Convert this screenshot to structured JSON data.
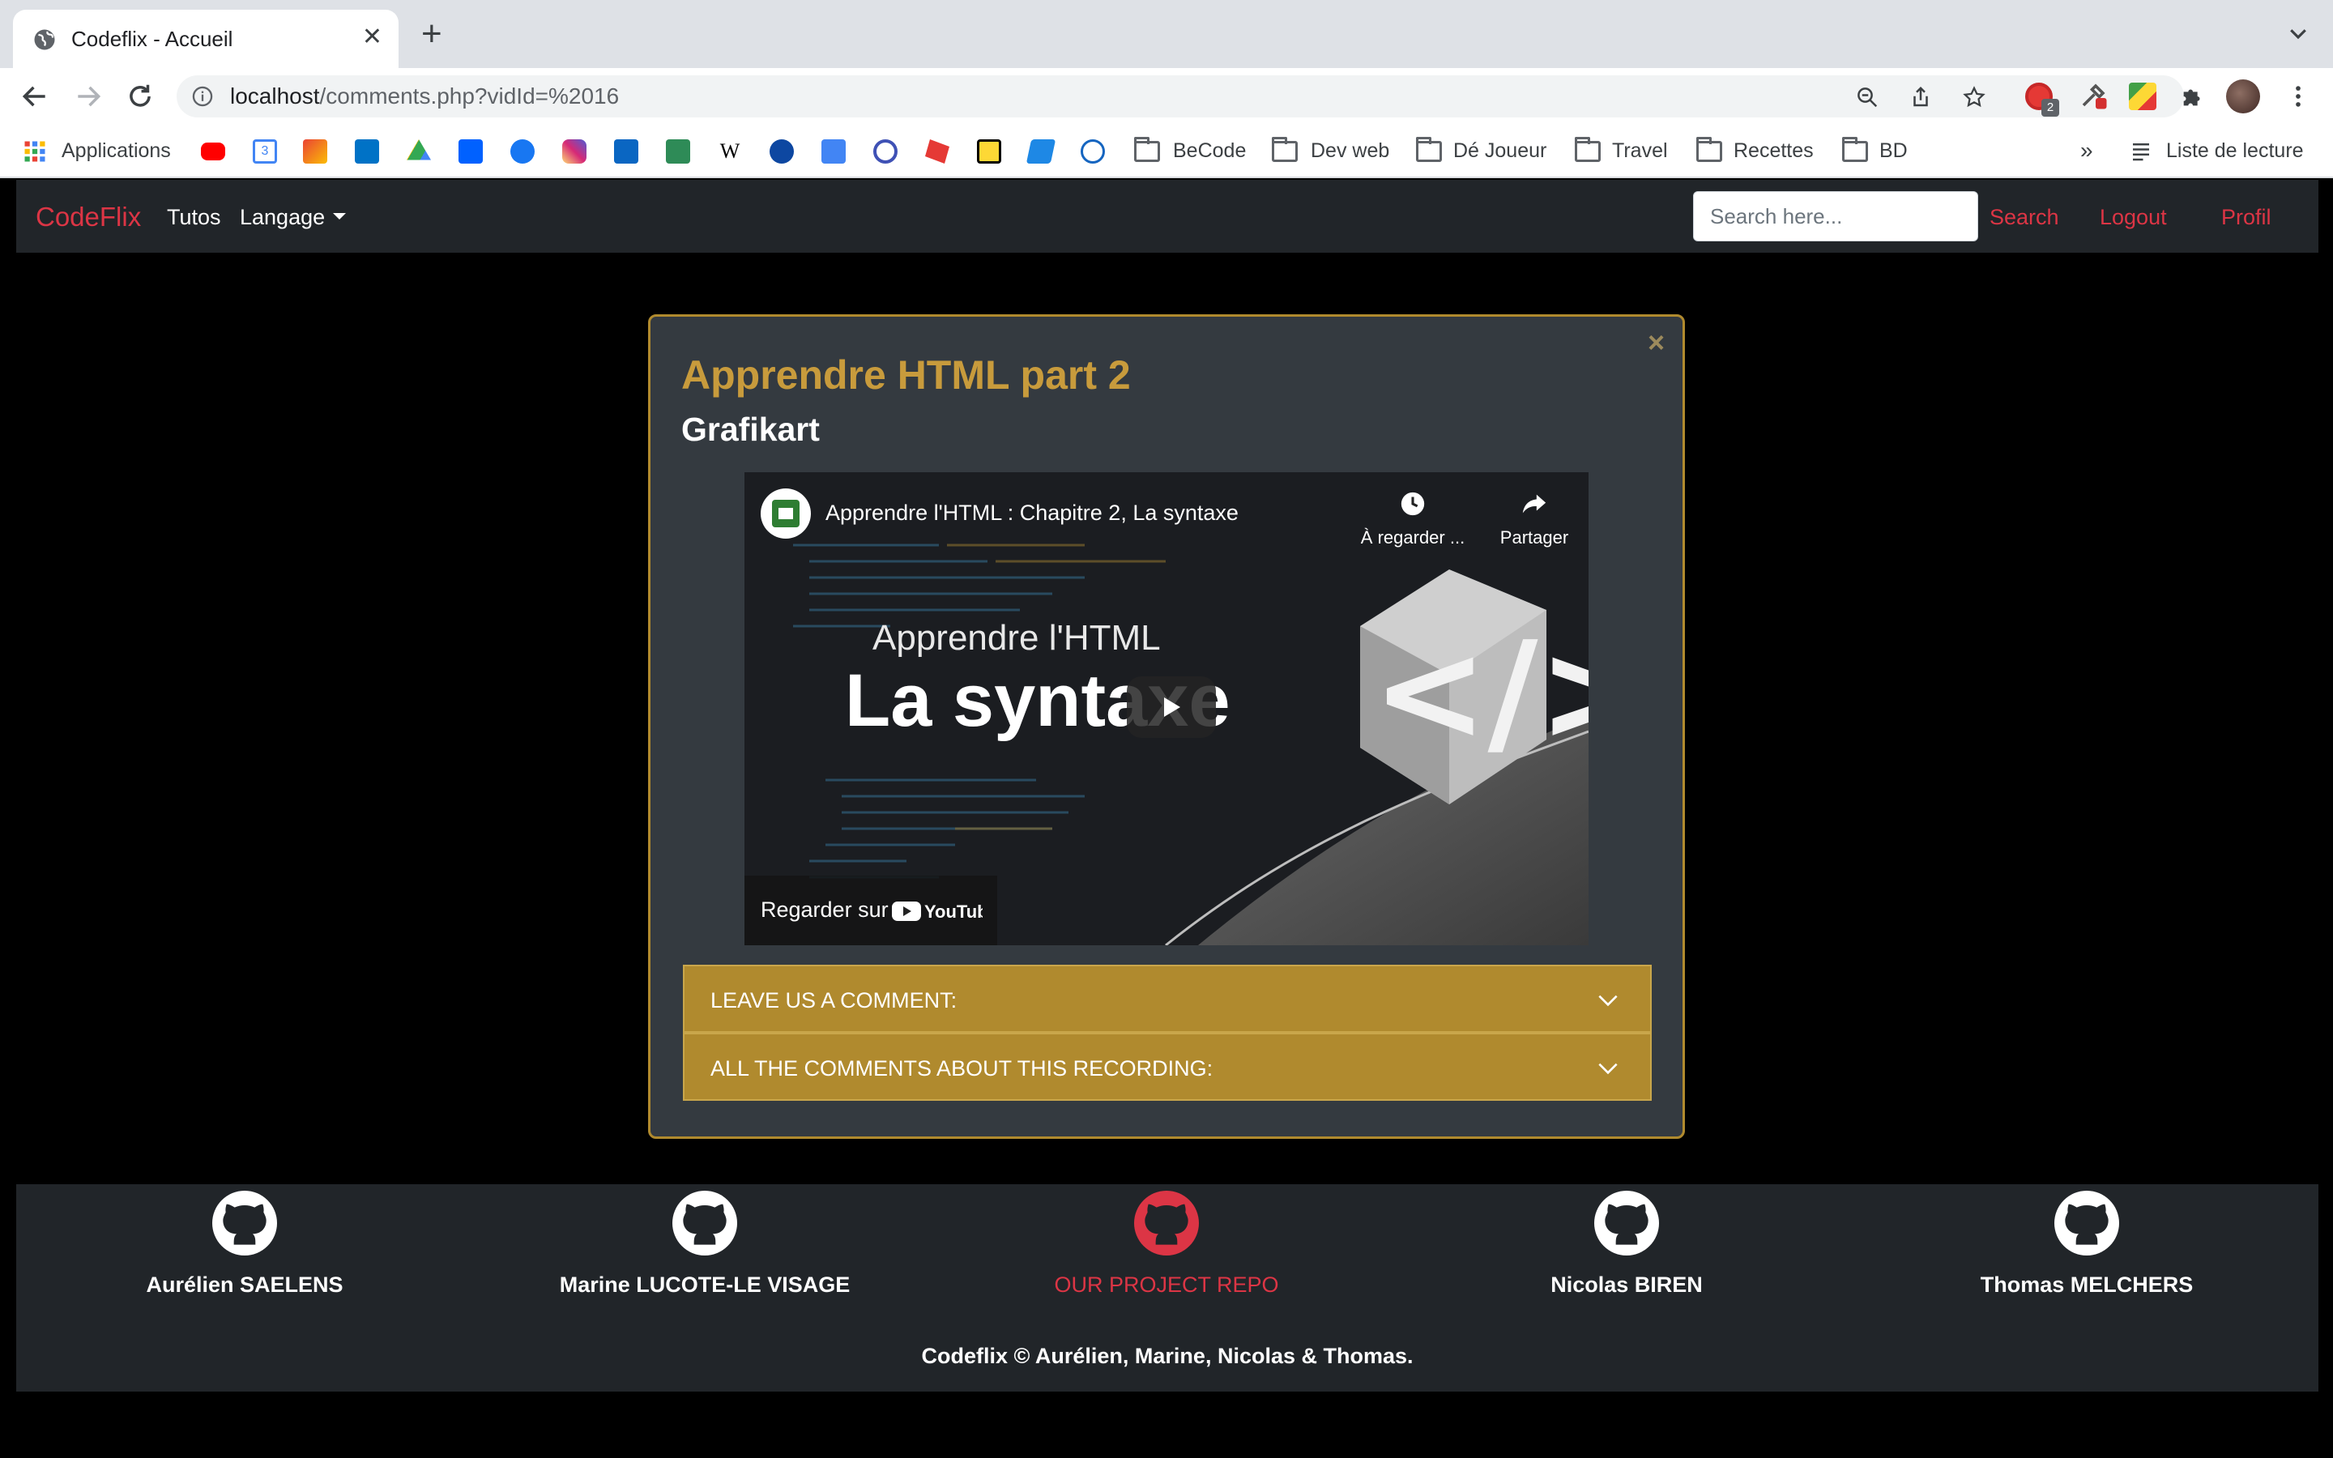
{
  "browser": {
    "tab_title": "Codeflix - Accueil",
    "url_host": "localhost",
    "url_path": "/comments.php?vidId=%2016",
    "extension_badge": "2",
    "bookmarks": {
      "apps_label": "Applications",
      "folders": [
        "BeCode",
        "Dev web",
        "Dé Joueur",
        "Travel",
        "Recettes",
        "BD"
      ],
      "overflow": "»",
      "reading_list": "Liste de lecture"
    }
  },
  "navbar": {
    "brand": "CodeFlix",
    "tutos": "Tutos",
    "langage": "Langage",
    "search_placeholder": "Search here...",
    "search": "Search",
    "logout": "Logout",
    "profil": "Profil"
  },
  "card": {
    "close": "×",
    "title": "Apprendre HTML part 2",
    "author": "Grafikart",
    "video": {
      "title": "Apprendre l'HTML : Chapitre 2, La syntaxe",
      "watch_later": "À regarder ...",
      "share": "Partager",
      "thumb_line1": "Apprendre l'HTML",
      "thumb_line2": "La syntaxe",
      "watch_on": "Regarder sur",
      "youtube": "YouTube"
    },
    "accordion": {
      "leave_comment": "LEAVE US A COMMENT:",
      "all_comments": "ALL THE COMMENTS ABOUT THIS RECORDING:"
    }
  },
  "footer": {
    "members": [
      "Aurélien SAELENS",
      "Marine LUCOTE-LE VISAGE",
      "OUR PROJECT REPO",
      "Nicolas BIREN",
      "Thomas MELCHERS"
    ],
    "copyright": "Codeflix © Aurélien, Marine, Nicolas & Thomas."
  },
  "colors": {
    "accent_red": "#dc3545",
    "gold": "#b08a2e",
    "card_bg": "#343a40",
    "navbar_bg": "#212529"
  }
}
